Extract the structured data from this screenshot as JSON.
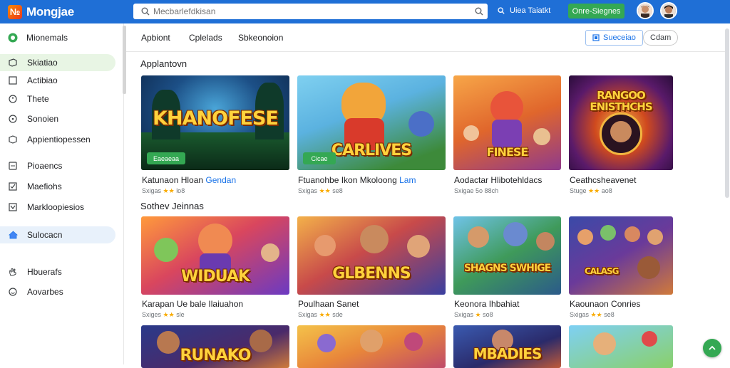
{
  "app": {
    "logo_text": "Mongjae",
    "logo_glyph": "№",
    "brand_color": "#1f6fd6",
    "accent_green": "#34a853"
  },
  "search": {
    "placeholder": "Mecbarlefdkisan",
    "icon": "search-icon"
  },
  "top": {
    "link_label": "Uiea Taiatkt",
    "signin_label": "Onre-Siegnes"
  },
  "sidebar": {
    "items": [
      {
        "label": "Mionemals",
        "icon": "circle-check-icon"
      },
      {
        "label": "Skiatiao",
        "icon": "controller-icon"
      },
      {
        "label": "Actibiao",
        "icon": "square-icon"
      },
      {
        "label": "Thete",
        "icon": "clock-icon"
      },
      {
        "label": "Sonoien",
        "icon": "circle-icon"
      },
      {
        "label": "Appientiopessen",
        "icon": "box-icon"
      },
      {
        "label": "Pioaencs",
        "icon": "file-icon"
      },
      {
        "label": "Maefiohs",
        "icon": "checkbox-icon"
      },
      {
        "label": "Markloopiesios",
        "icon": "check-square-icon"
      },
      {
        "label": "Sulocacn",
        "icon": "home-icon"
      },
      {
        "label": "Hbuerafs",
        "icon": "hand-icon"
      },
      {
        "label": "Aovarbes",
        "icon": "smile-icon"
      }
    ]
  },
  "tabs": {
    "items": [
      "Apbiont",
      "Cplelads",
      "Sbkeonoion"
    ],
    "button_primary": "Sueceiao",
    "button_secondary": "Cdam"
  },
  "sections": [
    {
      "title": "Applantovn",
      "cards": [
        {
          "title_art": "KHANOFESE",
          "badge": "Eaeaeaa",
          "name": "Katunaon Hloan",
          "name_ext": "Gendan",
          "meta": "Sxigas",
          "stars": "★★",
          "meta_tail": "lo8"
        },
        {
          "title_art": "CARLIVES",
          "badge": "Cicae",
          "name": "Ftuanohbe Ikon Mkoloong",
          "name_ext": "Lam",
          "meta": "Sxigas",
          "stars": "★★",
          "meta_tail": "se8"
        },
        {
          "title_art": "FINESE",
          "badge": "",
          "name": "Aodactar Hlibotehldacs",
          "name_ext": "",
          "meta": "Sxigae",
          "stars": "",
          "meta_tail": "5o 88ch"
        },
        {
          "title_art": "RANGOO ENISTHCHS",
          "badge": "",
          "name": "Ceathcsheavenet",
          "name_ext": "",
          "meta": "Stuge",
          "stars": "★★",
          "meta_tail": "ao8"
        }
      ]
    },
    {
      "title": "Sothev Jeinnas",
      "cards": [
        {
          "title_art": "WIDUAK",
          "badge": "",
          "name": "Karapan Ue bale Ilaiuahon",
          "name_ext": "",
          "meta": "Sxiges",
          "stars": "★★",
          "meta_tail": "sle"
        },
        {
          "title_art": "GLBENNS",
          "badge": "",
          "name": "Poulhaan Sanet",
          "name_ext": "",
          "meta": "Sxigas",
          "stars": "★★",
          "meta_tail": "sde"
        },
        {
          "title_art": "SHAGNS SWHIGE",
          "badge": "",
          "name": "Keonora Ihbahiat",
          "name_ext": "",
          "meta": "Sxigas",
          "stars": "★",
          "meta_tail": "so8"
        },
        {
          "title_art": "CALASG",
          "badge": "",
          "name": "Kaounaon Conries",
          "name_ext": "",
          "meta": "Sxigas",
          "stars": "★★",
          "meta_tail": "se8"
        }
      ]
    },
    {
      "title": "",
      "cards": [
        {
          "title_art": "RUNAKO",
          "badge": "",
          "name": "",
          "name_ext": "",
          "meta": "",
          "stars": "",
          "meta_tail": ""
        },
        {
          "title_art": "",
          "badge": "",
          "name": "",
          "name_ext": "",
          "meta": "",
          "stars": "",
          "meta_tail": ""
        },
        {
          "title_art": "MBADIES",
          "badge": "",
          "name": "",
          "name_ext": "",
          "meta": "",
          "stars": "",
          "meta_tail": ""
        },
        {
          "title_art": "",
          "badge": "",
          "name": "",
          "name_ext": "",
          "meta": "",
          "stars": "",
          "meta_tail": ""
        }
      ]
    }
  ]
}
